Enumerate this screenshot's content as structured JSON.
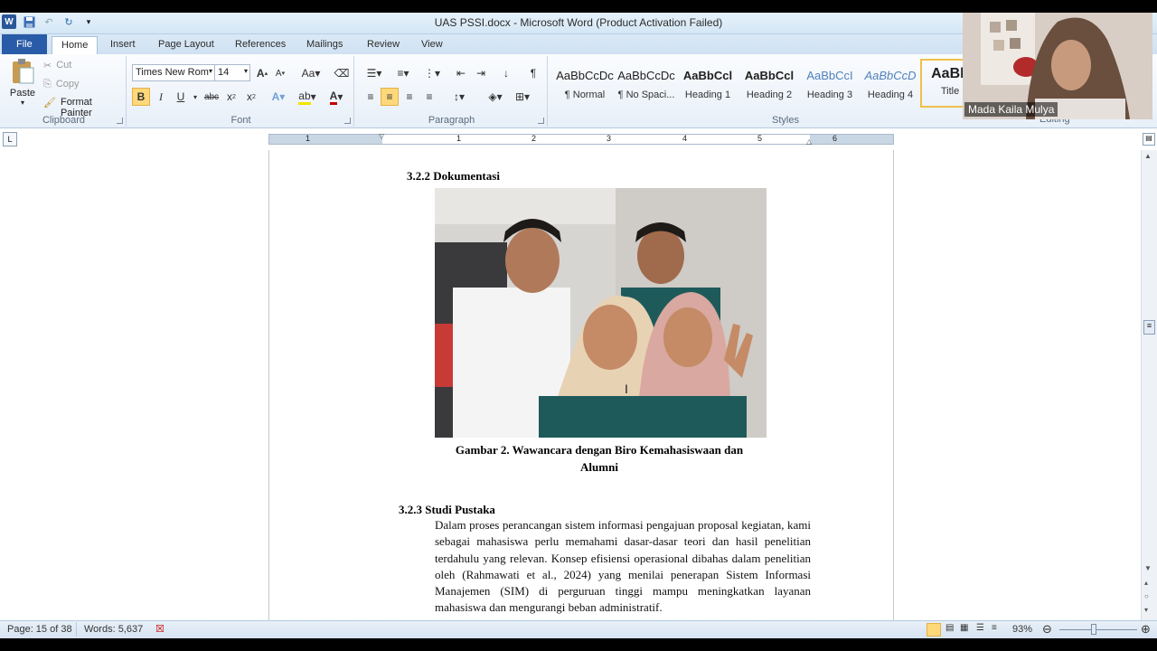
{
  "window": {
    "title": "UAS PSSI.docx  -  Microsoft Word (Product Activation Failed)"
  },
  "tabs": [
    "File",
    "Home",
    "Insert",
    "Page Layout",
    "References",
    "Mailings",
    "Review",
    "View"
  ],
  "clipboard": {
    "paste": "Paste",
    "cut": "Cut",
    "copy": "Copy",
    "format_painter": "Format Painter",
    "group": "Clipboard"
  },
  "font": {
    "name": "Times New Rom",
    "size": "14",
    "group": "Font"
  },
  "paragraph": {
    "group": "Paragraph"
  },
  "styles": {
    "group": "Styles",
    "items": [
      {
        "preview": "AaBbCcDc",
        "name": "¶ Normal"
      },
      {
        "preview": "AaBbCcDc",
        "name": "¶ No Spaci..."
      },
      {
        "preview": "AaBbCcl",
        "name": "Heading 1"
      },
      {
        "preview": "AaBbCcl",
        "name": "Heading 2"
      },
      {
        "preview": "AaBbCcI",
        "name": "Heading 3"
      },
      {
        "preview": "AaBbCcD",
        "name": "Heading 4"
      },
      {
        "preview": "AaBb",
        "name": "Title"
      }
    ]
  },
  "editing": {
    "group": "Editing"
  },
  "ruler": {
    "numbers": [
      "1",
      "1",
      "2",
      "3",
      "4",
      "5",
      "6"
    ]
  },
  "document": {
    "heading_1": "3.2.2 Dokumentasi",
    "caption": "Gambar 2. Wawancara dengan Biro Kemahasiswaan dan Alumni",
    "heading_2": "3.2.3 Studi Pustaka",
    "paragraph": "Dalam proses perancangan sistem informasi pengajuan proposal kegiatan, kami sebagai mahasiswa perlu memahami dasar-dasar teori dan hasil penelitian terdahulu yang relevan. Konsep efisiensi operasional dibahas dalam penelitian oleh (Rahmawati et al., 2024) yang menilai penerapan Sistem Informasi Manajemen (SIM) di perguruan tinggi mampu meningkatkan layanan mahasiswa dan mengurangi beban administratif."
  },
  "status": {
    "page": "Page: 15 of 38",
    "words": "Words: 5,637",
    "zoom": "93%"
  },
  "webcam": {
    "name": "Mada Kaila Mulya"
  },
  "colors": {
    "file_tab": "#2a5ba8",
    "highlight": "#ffd87a",
    "font_color": "#c00000"
  }
}
